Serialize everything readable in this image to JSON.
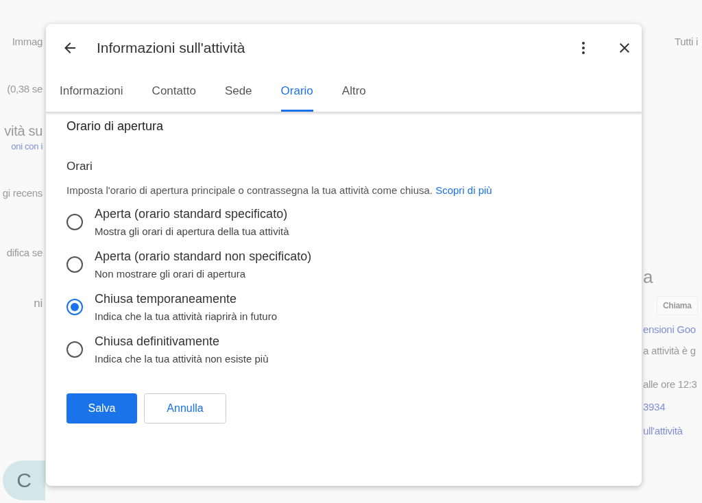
{
  "background": {
    "left_texts": [
      {
        "text": "Immag",
        "kind": "chip"
      },
      {
        "text": "(0,38 se",
        "kind": "muted"
      },
      {
        "text": "vità su",
        "kind": "heading"
      },
      {
        "text": "oni con i",
        "kind": "link"
      },
      {
        "text": "gi recens",
        "kind": "action"
      },
      {
        "text": "difica se",
        "kind": "action"
      },
      {
        "text": "ni",
        "kind": "muted"
      }
    ],
    "avatar": "C",
    "right_texts": [
      {
        "text": "Tutti i",
        "kind": "chip"
      },
      {
        "text": "a",
        "kind": "heading"
      },
      {
        "text": "Chiama",
        "kind": "button"
      },
      {
        "text": "ensioni Goo",
        "kind": "link"
      },
      {
        "text": "a attività è g",
        "kind": "muted"
      },
      {
        "text": "alle ore 12:3",
        "kind": "muted"
      },
      {
        "text": "3934",
        "kind": "link"
      },
      {
        "text": "ull'attività",
        "kind": "link"
      }
    ]
  },
  "dialog": {
    "title": "Informazioni sull'attività",
    "tabs": [
      {
        "label": "Informazioni",
        "selected": false
      },
      {
        "label": "Contatto",
        "selected": false
      },
      {
        "label": "Sede",
        "selected": false
      },
      {
        "label": "Orario",
        "selected": true
      },
      {
        "label": "Altro",
        "selected": false
      }
    ],
    "section_title": "Orario di apertura",
    "subtitle": "Orari",
    "description": "Imposta l'orario di apertura principale o contrassegna la tua attività come chiusa.",
    "learn_more": "Scopri di più",
    "options": [
      {
        "label": "Aperta (orario standard specificato)",
        "hint": "Mostra gli orari di apertura della tua attività",
        "selected": false
      },
      {
        "label": "Aperta (orario standard non specificato)",
        "hint": "Non mostrare gli orari di apertura",
        "selected": false
      },
      {
        "label": "Chiusa temporaneamente",
        "hint": "Indica che la tua attività riaprirà in futuro",
        "selected": true
      },
      {
        "label": "Chiusa definitivamente",
        "hint": "Indica che la tua attività non esiste più",
        "selected": false
      }
    ],
    "buttons": [
      {
        "label": "Salva",
        "kind": "primary"
      },
      {
        "label": "Annulla",
        "kind": "secondary"
      }
    ]
  }
}
